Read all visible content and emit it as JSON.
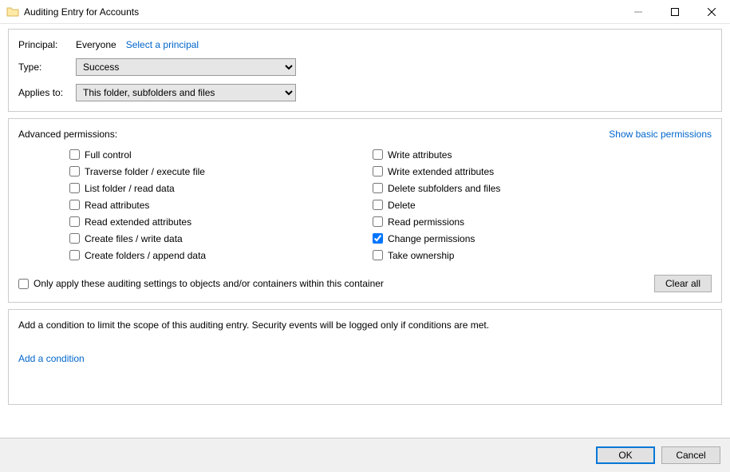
{
  "window": {
    "title": "Auditing Entry for Accounts"
  },
  "principal": {
    "label": "Principal:",
    "value": "Everyone",
    "select_link": "Select a principal"
  },
  "type": {
    "label": "Type:",
    "value": "Success"
  },
  "applies_to": {
    "label": "Applies to:",
    "value": "This folder, subfolders and files"
  },
  "advanced_permissions": {
    "heading": "Advanced permissions:",
    "toggle_link": "Show basic permissions",
    "left": [
      {
        "label": "Full control",
        "checked": false
      },
      {
        "label": "Traverse folder / execute file",
        "checked": false
      },
      {
        "label": "List folder / read data",
        "checked": false
      },
      {
        "label": "Read attributes",
        "checked": false
      },
      {
        "label": "Read extended attributes",
        "checked": false
      },
      {
        "label": "Create files / write data",
        "checked": false
      },
      {
        "label": "Create folders / append data",
        "checked": false
      }
    ],
    "right": [
      {
        "label": "Write attributes",
        "checked": false
      },
      {
        "label": "Write extended attributes",
        "checked": false
      },
      {
        "label": "Delete subfolders and files",
        "checked": false
      },
      {
        "label": "Delete",
        "checked": false
      },
      {
        "label": "Read permissions",
        "checked": false
      },
      {
        "label": "Change permissions",
        "checked": true
      },
      {
        "label": "Take ownership",
        "checked": false
      }
    ],
    "only_apply": {
      "label": "Only apply these auditing settings to objects and/or containers within this container",
      "checked": false
    },
    "clear_all": "Clear all"
  },
  "conditions": {
    "description": "Add a condition to limit the scope of this auditing entry. Security events will be logged only if conditions are met.",
    "add_link": "Add a condition"
  },
  "buttons": {
    "ok": "OK",
    "cancel": "Cancel"
  }
}
